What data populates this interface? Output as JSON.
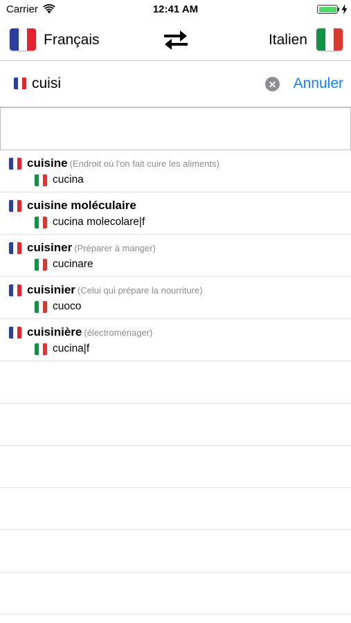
{
  "status_bar": {
    "carrier": "Carrier",
    "time": "12:41 AM",
    "battery_level": 1.0
  },
  "header": {
    "source_language": "Français",
    "target_language": "Italien",
    "swap_icon": "swap-arrows-icon"
  },
  "search": {
    "query": "cuisi",
    "cancel_label": "Annuler",
    "clear_icon": "clear-circle-icon"
  },
  "colors": {
    "accent": "#147efb",
    "secondary_text": "#8e8e93",
    "battery": "#4cd964",
    "flag_fr": [
      "#2a3f9e",
      "#ffffff",
      "#e1242e"
    ],
    "flag_it": [
      "#109346",
      "#ffffff",
      "#d63a30"
    ]
  },
  "results": [
    {
      "word": "cuisine",
      "gloss": "(Endroit où l'on fait cuire les aliments)",
      "translation": "cucina"
    },
    {
      "word": "cuisine moléculaire",
      "gloss": "",
      "translation": "cucina molecolare|f"
    },
    {
      "word": "cuisiner",
      "gloss": "(Préparer à manger)",
      "translation": "cucinare"
    },
    {
      "word": "cuisinier",
      "gloss": "(Celui qui prépare la nourriture)",
      "translation": "cuoco"
    },
    {
      "word": "cuisinière",
      "gloss": "(électroménager)",
      "translation": "cucina|f"
    }
  ]
}
